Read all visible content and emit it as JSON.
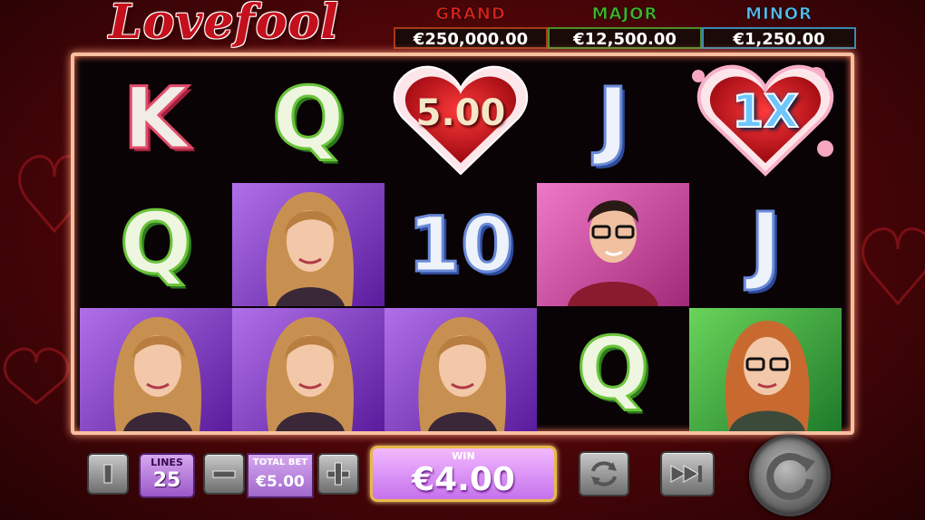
{
  "game": {
    "title": "Lovefool"
  },
  "jackpots": [
    {
      "label": "GRAND",
      "value": "€250,000.00",
      "label_color": "#d4201a",
      "border_color": "#a83818"
    },
    {
      "label": "MAJOR",
      "value": "€12,500.00",
      "label_color": "#43b02a",
      "border_color": "#4e8e2a"
    },
    {
      "label": "MINOR",
      "value": "€1,250.00",
      "label_color": "#58b8e8",
      "border_color": "#3c88b0"
    }
  ],
  "reels": {
    "row1": [
      {
        "kind": "letter",
        "text": "K"
      },
      {
        "kind": "letter",
        "text": "Q"
      },
      {
        "kind": "heart",
        "text": "5.00"
      },
      {
        "kind": "letter",
        "text": "J"
      },
      {
        "kind": "heart-multiplier",
        "text": "1X"
      }
    ],
    "row2": [
      {
        "kind": "letter",
        "text": "Q"
      },
      {
        "kind": "portrait",
        "subject": "blonde-woman"
      },
      {
        "kind": "letter",
        "text": "10"
      },
      {
        "kind": "portrait",
        "subject": "man-with-glasses"
      },
      {
        "kind": "letter",
        "text": "J"
      }
    ],
    "row3": [
      {
        "kind": "portrait",
        "subject": "blonde-woman"
      },
      {
        "kind": "portrait",
        "subject": "blonde-woman"
      },
      {
        "kind": "portrait",
        "subject": "blonde-woman"
      },
      {
        "kind": "letter",
        "text": "Q"
      },
      {
        "kind": "portrait",
        "subject": "redhead-woman-with-glasses"
      }
    ]
  },
  "controls": {
    "info_icon": "info-icon",
    "lines": {
      "label": "LINES",
      "value": "25"
    },
    "total_bet": {
      "label": "TOTAL BET",
      "value": "€5.00"
    },
    "minus_icon": "minus-icon",
    "plus_icon": "plus-icon",
    "win": {
      "label": "WIN",
      "value": "€4.00"
    },
    "autoplay_icon": "autoplay-icon",
    "turbo_icon": "fast-forward-icon",
    "spin_icon": "spin-icon"
  }
}
